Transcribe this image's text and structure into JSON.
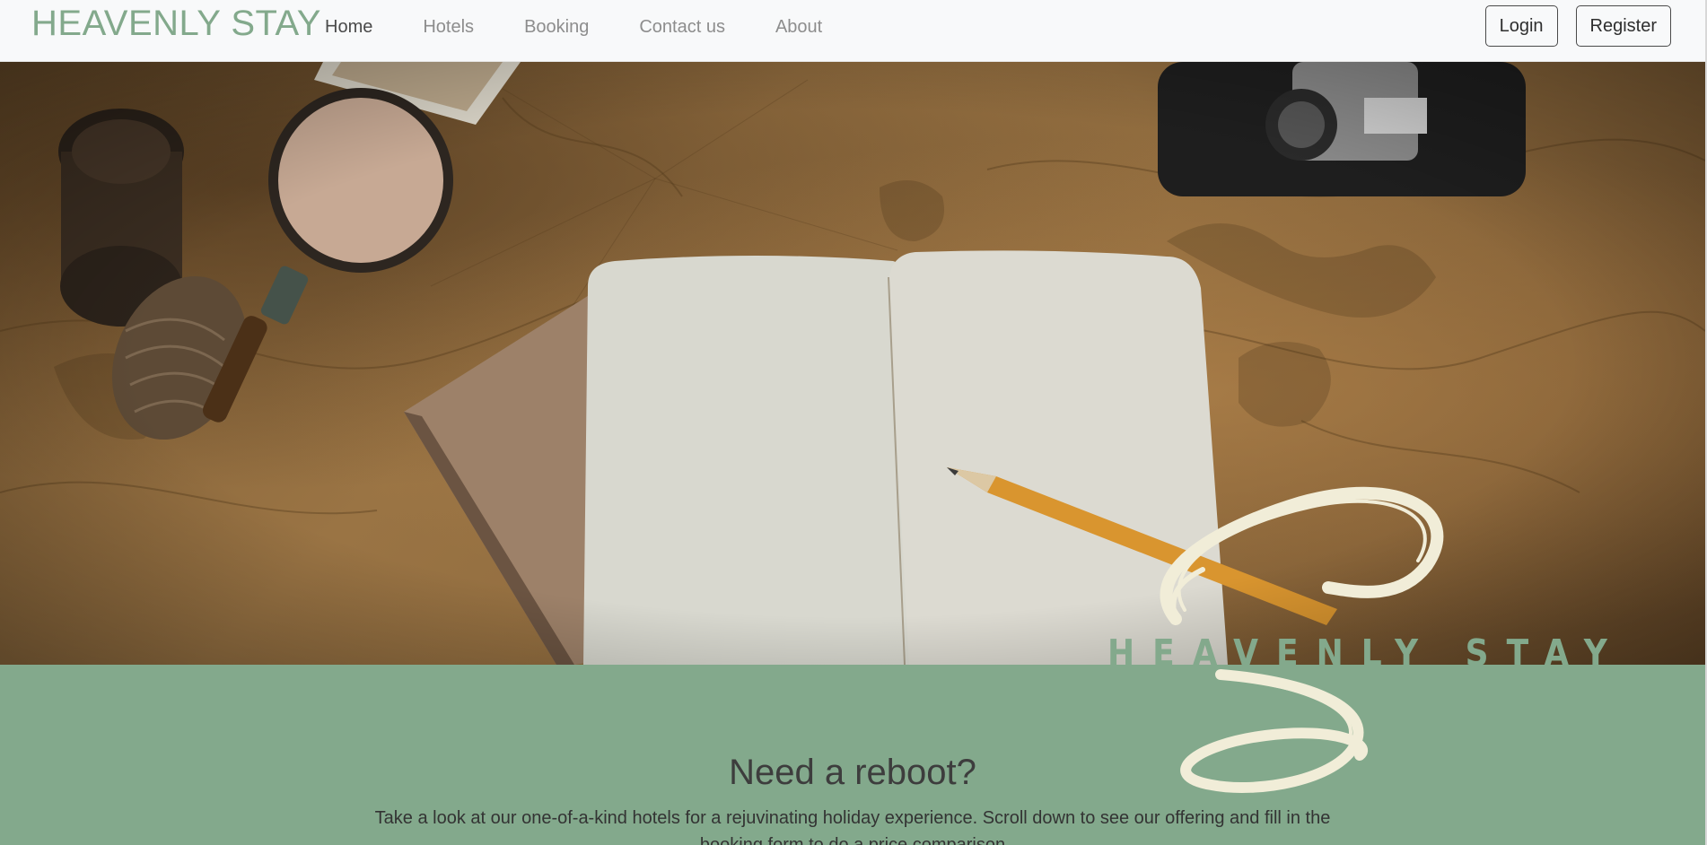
{
  "brand": "HEAVENLY STAY",
  "nav": {
    "items": [
      {
        "label": "Home",
        "active": true
      },
      {
        "label": "Hotels",
        "active": false
      },
      {
        "label": "Booking",
        "active": false
      },
      {
        "label": "Contact us",
        "active": false
      },
      {
        "label": "About",
        "active": false
      }
    ],
    "login_label": "Login",
    "register_label": "Register"
  },
  "hero": {
    "logo_text": "HEAVENLY STAY"
  },
  "section": {
    "title": "Need a reboot?",
    "text": "Take a look at our one-of-a-kind hotels for a rejuvinating holiday experience. Scroll down to see our offering and fill in the booking form to do a price comparison"
  },
  "colors": {
    "brand_green": "#83a98c",
    "navbar_bg": "#f8f9fa",
    "logo_cream": "#f1edd8"
  }
}
